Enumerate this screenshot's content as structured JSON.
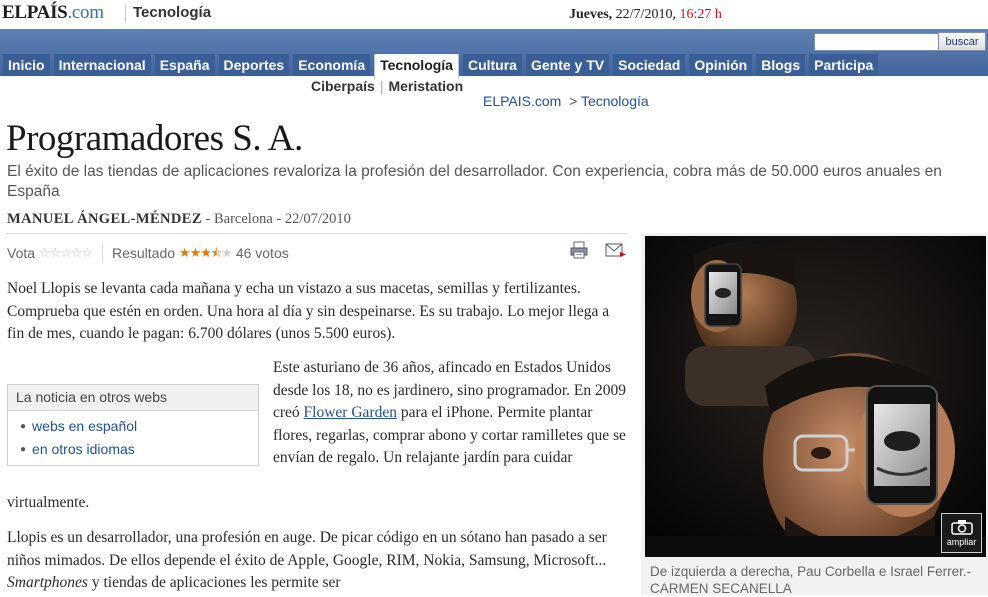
{
  "header": {
    "logo_main": "ELPAÍS",
    "logo_com": ".com",
    "section": "Tecnología",
    "date_day": "Jueves,",
    "date": "22/7/2010,",
    "time": "16:27 h"
  },
  "search": {
    "placeholder": "",
    "button_label": "buscar"
  },
  "nav": {
    "tabs": [
      {
        "label": "Inicio"
      },
      {
        "label": "Internacional"
      },
      {
        "label": "España"
      },
      {
        "label": "Deportes"
      },
      {
        "label": "Economía"
      },
      {
        "label": "Tecnología",
        "active": true
      },
      {
        "label": "Cultura"
      },
      {
        "label": "Gente y TV"
      },
      {
        "label": "Sociedad"
      },
      {
        "label": "Opinión"
      },
      {
        "label": "Blogs"
      },
      {
        "label": "Participa"
      }
    ],
    "subnav": [
      "Ciberpaís",
      "Meristation"
    ]
  },
  "breadcrumb": {
    "home": "ELPAIS.com",
    "sep": ">",
    "section": "Tecnología"
  },
  "article": {
    "headline": "Programadores S. A.",
    "subtitle": "El éxito de las tiendas de aplicaciones revaloriza la profesión del desarrollador. Con experiencia, cobra más de 50.000 euros anuales en España",
    "author": "MANUEL ÁNGEL-MÉNDEZ",
    "place_date": " - Barcelona - 22/07/2010",
    "vote_label": "Vota",
    "result_label": "Resultado",
    "rating": 3.5,
    "votes": "46 votos",
    "para1": "Noel Llopis se levanta cada mañana y echa un vistazo a sus macetas, semillas y fertilizantes. Comprueba que estén en orden. Una hora al día y sin despeinarse. Es su trabajo. Lo mejor llega a fin de mes, cuando le pagan: 6.700 dólares (unos 5.500 euros).",
    "para2_a": "Este asturiano de 36 años, afincado en Estados Unidos desde los 18, no es jardinero, sino programador. En 2009 creó ",
    "para2_link": "Flower Garden",
    "para2_b": " para el iPhone. Permite plantar flores, regarlas, comprar abono y cortar ramilletes que se envían de regalo. Un relajante jardín para cuidar",
    "para2_end": "virtualmente.",
    "para3_a": "Llopis es un desarrollador, una profesión en auge. De picar código en un sótano han pasado a ser niños mimados. De ellos depende el éxito de Apple, Google, RIM, Nokia, Samsung, Microsoft... ",
    "para3_em": "Smartphones",
    "para3_b": " y tiendas de aplicaciones les permite ser"
  },
  "other_sites": {
    "title": "La noticia en otros webs",
    "items": [
      "webs en español",
      "en otros idiomas"
    ]
  },
  "photo": {
    "zoom_label": "ampliar",
    "caption": "De izquierda a derecha, Pau Corbella e Israel Ferrer.- CARMEN SECANELLA"
  },
  "icons": {
    "print": "print-icon",
    "mail": "mail-icon",
    "zoom": "camera-zoom-icon"
  },
  "colors": {
    "nav_blue": "#3d6198",
    "link_blue": "#24508f",
    "time_red": "#c0141c",
    "star_orange": "#e07b00"
  }
}
